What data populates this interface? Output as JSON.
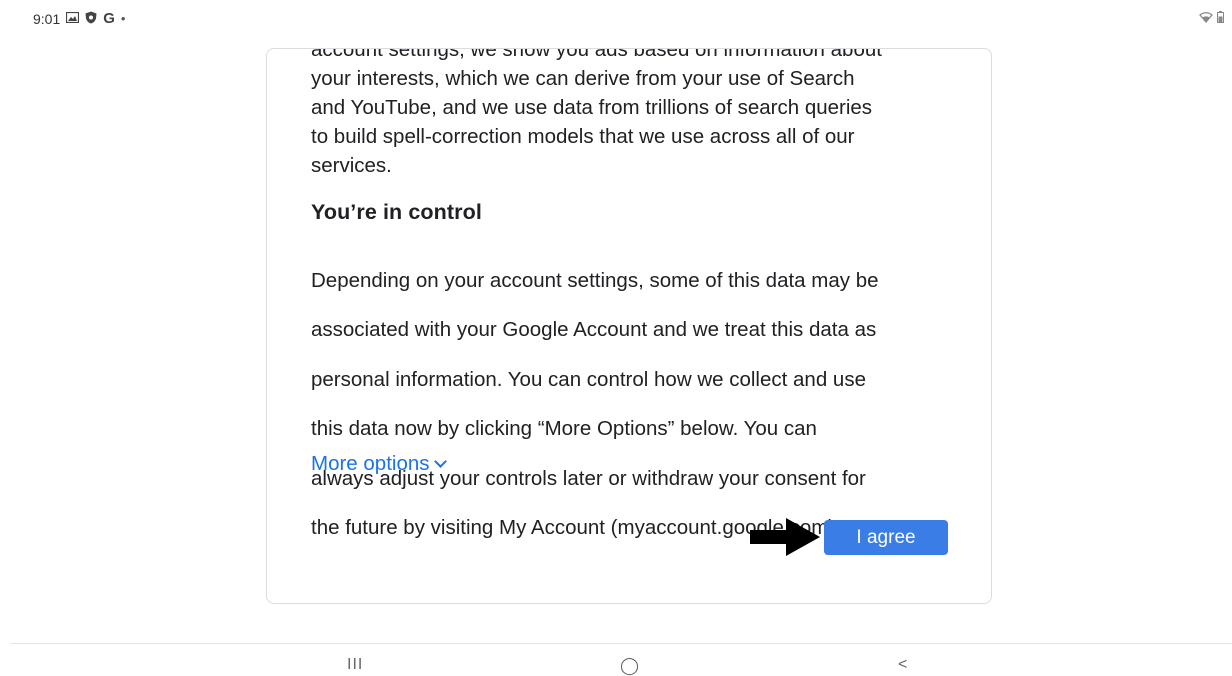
{
  "status_bar": {
    "time": "9:01",
    "notification_icons": [
      "gallery-icon",
      "shield-icon",
      "google-icon"
    ],
    "google_glyph": "G",
    "dot": "•",
    "right_icons": [
      "wifi-icon",
      "battery-icon"
    ]
  },
  "consent": {
    "partial_top_line": "account settings, we show you ads based on information about",
    "intro_lines": [
      "your interests, which we can derive from your use of Search",
      "and YouTube, and we use data from trillions of search queries",
      "to build spell-correction models that we use across all of our",
      "services."
    ],
    "heading": "You’re in control",
    "body_lines": [
      "Depending on your account settings, some of this data may be",
      "associated with your Google Account and we treat this data as",
      "personal information. You can control how we collect and use",
      "this data now by clicking “More Options” below. You can",
      "always adjust your controls later or withdraw your consent for",
      "the future by visiting My Account (myaccount.google.com)."
    ],
    "more_options_label": "More options",
    "agree_label": "I agree",
    "link_color": "#1a73e8",
    "button_color": "#3a7de6"
  },
  "nav_bar": {
    "recents_glyph": "III",
    "home_glyph": "◯",
    "back_glyph": "<"
  }
}
